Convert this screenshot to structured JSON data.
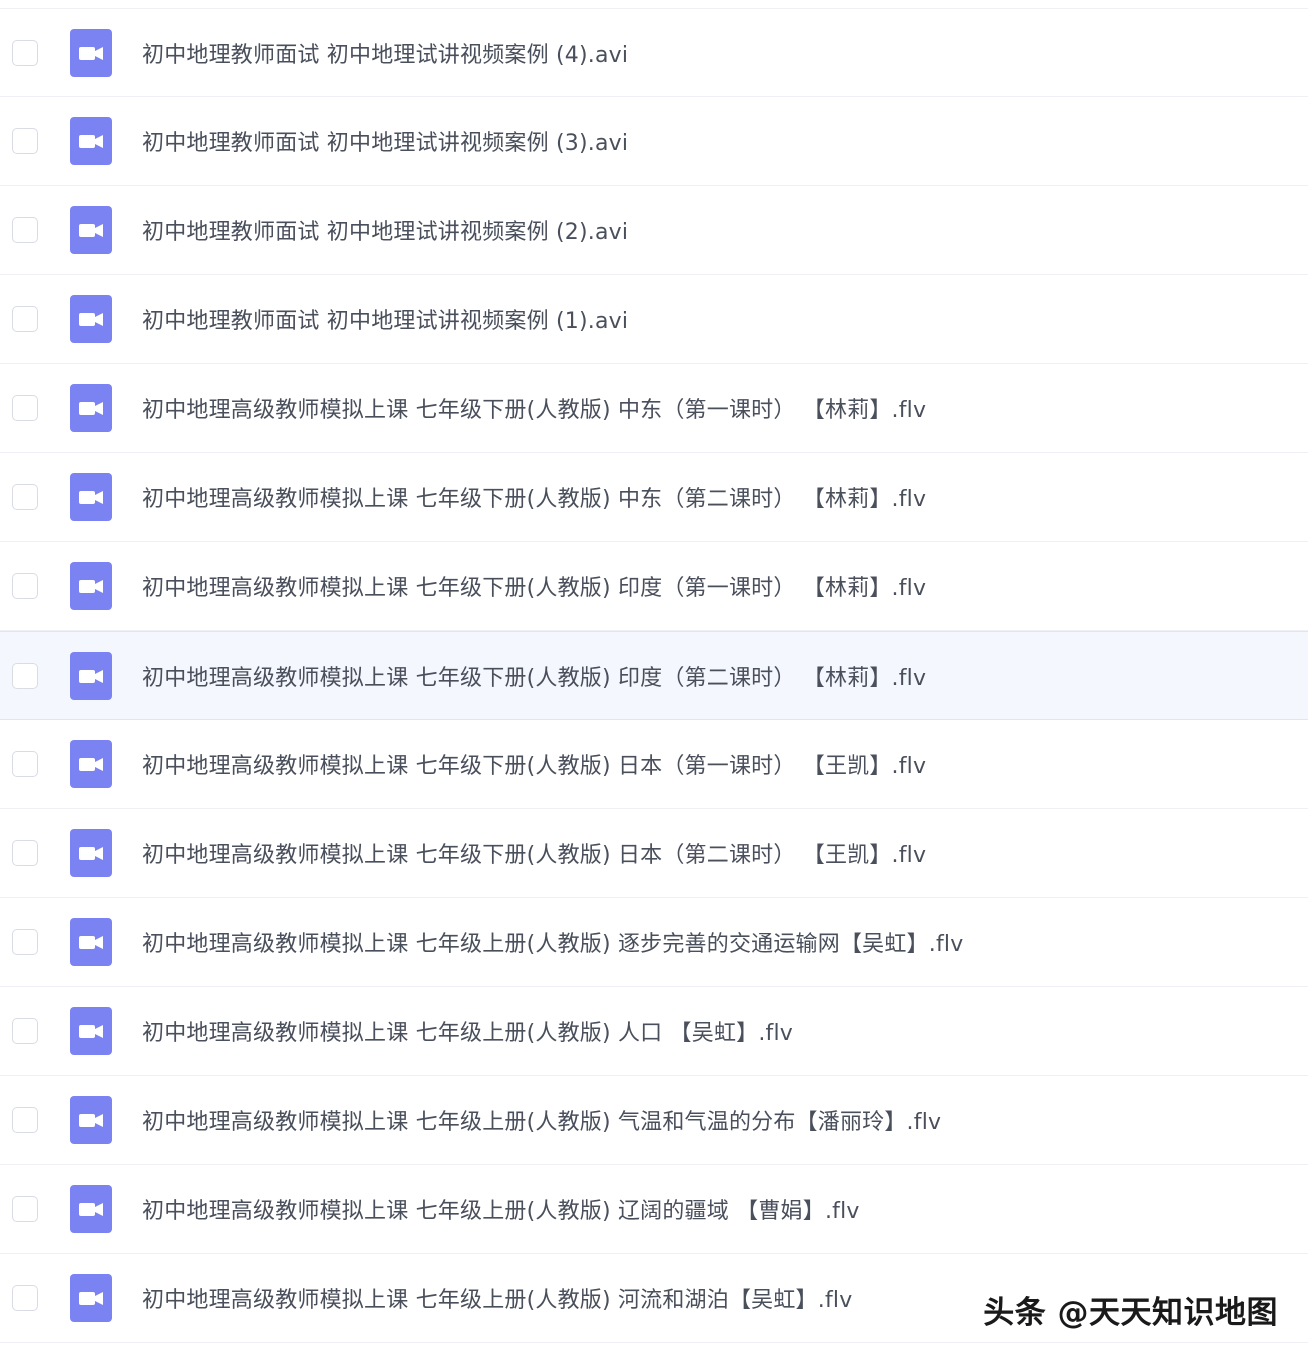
{
  "file_icon": "video-file-icon",
  "accent_color": "#7b83f2",
  "files": [
    {
      "name": "初中地理教师面试 初中地理试讲视频案例 (4).avi"
    },
    {
      "name": "初中地理教师面试 初中地理试讲视频案例 (3).avi"
    },
    {
      "name": "初中地理教师面试 初中地理试讲视频案例 (2).avi"
    },
    {
      "name": "初中地理教师面试 初中地理试讲视频案例 (1).avi"
    },
    {
      "name": "初中地理高级教师模拟上课 七年级下册(人教版) 中东（第一课时） 【林莉】.flv"
    },
    {
      "name": "初中地理高级教师模拟上课 七年级下册(人教版) 中东（第二课时） 【林莉】.flv"
    },
    {
      "name": "初中地理高级教师模拟上课 七年级下册(人教版) 印度（第一课时） 【林莉】.flv"
    },
    {
      "name": "初中地理高级教师模拟上课 七年级下册(人教版) 印度（第二课时） 【林莉】.flv"
    },
    {
      "name": "初中地理高级教师模拟上课 七年级下册(人教版) 日本（第一课时） 【王凯】.flv"
    },
    {
      "name": "初中地理高级教师模拟上课 七年级下册(人教版) 日本（第二课时） 【王凯】.flv"
    },
    {
      "name": "初中地理高级教师模拟上课 七年级上册(人教版) 逐步完善的交通运输网【吴虹】.flv"
    },
    {
      "name": "初中地理高级教师模拟上课 七年级上册(人教版) 人口 【吴虹】.flv"
    },
    {
      "name": "初中地理高级教师模拟上课 七年级上册(人教版) 气温和气温的分布【潘丽玲】.flv"
    },
    {
      "name": "初中地理高级教师模拟上课 七年级上册(人教版) 辽阔的疆域 【曹娟】.flv"
    },
    {
      "name": "初中地理高级教师模拟上课 七年级上册(人教版) 河流和湖泊【吴虹】.flv"
    }
  ],
  "watermark": "头条 @天天知识地图"
}
